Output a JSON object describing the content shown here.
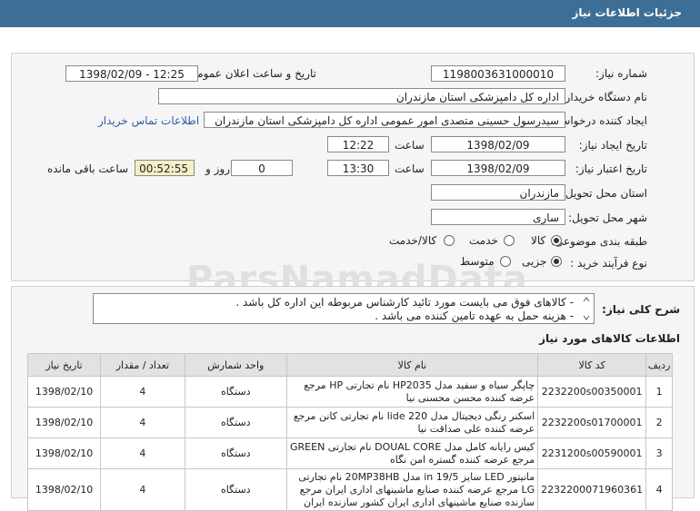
{
  "header": {
    "title": "جزئیات اطلاعات نیاز"
  },
  "form": {
    "need_number_label": "شماره نیاز:",
    "need_number": "1198003631000010",
    "announce_label": "تاریخ و ساعت اعلان عمومی:",
    "announce_value": "1398/02/09 - 12:25",
    "buyer_label": "نام دستگاه خریدار:",
    "buyer_value": "اداره کل دامپزشکی استان مازندران",
    "creator_label": "ایجاد کننده درخواست:",
    "creator_value": "سیدرسول حسینی متصدی امور عمومی اداره کل دامپزشکی استان مازندران",
    "contact_link": "اطلاعات تماس خریدار",
    "created_date_label": "تاریخ ایجاد نیاز:",
    "created_date": "1398/02/09",
    "time_label": "ساعت",
    "created_time": "12:22",
    "validity_label": "تاریخ اعتبار نیاز:",
    "validity_date": "1398/02/09",
    "validity_time": "13:30",
    "days_value": "0",
    "days_label": "روز و",
    "remaining_value": "00:52:55",
    "remaining_label": "ساعت باقی مانده",
    "province_label": "استان محل تحویل:",
    "province_value": "مازندران",
    "city_label": "شهر محل تحویل:",
    "city_value": "ساری",
    "category_label": "طبقه بندی موضوعی:",
    "category_options": [
      "کالا",
      "خدمت",
      "کالا/خدمت"
    ],
    "process_label": "نوع فرآیند خرید :",
    "process_options": [
      "جزیی",
      "متوسط"
    ]
  },
  "watermark": "ParsNamadData",
  "description": {
    "label": "شرح کلی نیاز:",
    "lines": [
      "- کالاهای فوق می بایست مورد تائید کارشناس مربوطه این اداره کل باشد .",
      "- هزینه حمل به عهده تامین کننده می باشد ."
    ]
  },
  "items_title": "اطلاعات کالاهای مورد نیاز",
  "table": {
    "headers": [
      "ردیف",
      "کد کالا",
      "نام کالا",
      "واحد شمارش",
      "تعداد / مقدار",
      "تاریخ نیاز"
    ],
    "rows": [
      [
        "1",
        "2232200s00350001",
        "چاپگر سیاه و سفید مدل HP2035 نام تجارتی HP مرجع عرضه کننده محسن محسنی نیا",
        "دستگاه",
        "4",
        "1398/02/10"
      ],
      [
        "2",
        "2232200s01700001",
        "اسکنر رنگی دیجیتال مدل lide 220 نام تجارتی کانن مرجع عرضه کننده علی صداقت نیا",
        "دستگاه",
        "4",
        "1398/02/10"
      ],
      [
        "3",
        "2231200s00590001",
        "کیس رایانه کامل مدل DOUAL CORE نام تجارتی GREEN مرجع عرضه کننده گستره امن نگاه",
        "دستگاه",
        "4",
        "1398/02/10"
      ],
      [
        "4",
        "2232200071960361",
        "مانیتور LED سایز 19/5 in مدل 20MP38HB نام تجارتی LG مرجع عرضه کننده صنایع ماشینهای اداری ایران مرجع سازنده صنایع ماشینهای اداری ایران کشور سازنده ایران",
        "دستگاه",
        "4",
        "1398/02/10"
      ]
    ]
  }
}
